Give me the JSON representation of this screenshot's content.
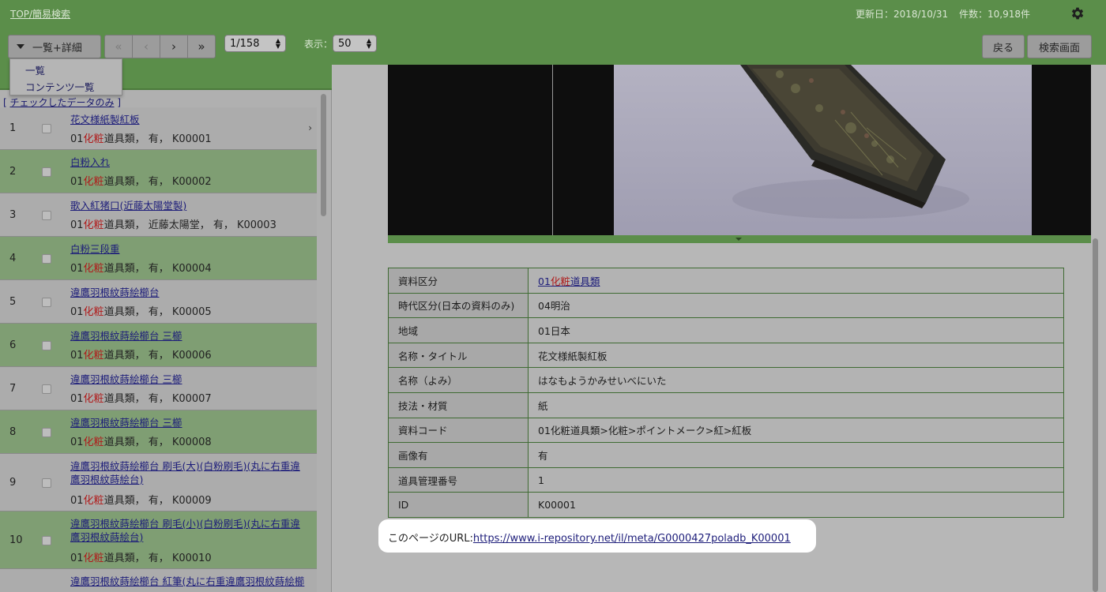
{
  "header": {
    "breadcrumb": "TOP/簡易検索",
    "updated": "更新日：2018/10/31",
    "count": "件数：10,918件",
    "icon": "gear-icon"
  },
  "toolbar": {
    "view_label": "一覧+詳細",
    "pager": [
      "«",
      "‹",
      "›",
      "»"
    ],
    "page_select": "1/158",
    "display_label": "表示：",
    "per_page": "50",
    "back_label": "戻る",
    "search_screen_label": "検索画面"
  },
  "dropdown": {
    "items": [
      "一覧",
      "コンテンツ一覧"
    ]
  },
  "left": {
    "checked_only": "チェックしたデータのみ",
    "rows": [
      {
        "num": "1",
        "title": "花文様紙製紅板",
        "pre": "01",
        "red": "化粧",
        "post": "道具類， 有， K00001"
      },
      {
        "num": "2",
        "title": "白粉入れ",
        "pre": "01",
        "red": "化粧",
        "post": "道具類， 有， K00002"
      },
      {
        "num": "3",
        "title": "歌入紅猪口(近藤太陽堂製)",
        "pre": "01",
        "red": "化粧",
        "post": "道具類， 近藤太陽堂， 有， K00003"
      },
      {
        "num": "4",
        "title": "白粉三段重",
        "pre": "01",
        "red": "化粧",
        "post": "道具類， 有， K00004"
      },
      {
        "num": "5",
        "title": "違鷹羽根紋蒔絵櫛台",
        "pre": "01",
        "red": "化粧",
        "post": "道具類， 有， K00005"
      },
      {
        "num": "6",
        "title": "違鷹羽根紋蒔絵櫛台 三櫛",
        "pre": "01",
        "red": "化粧",
        "post": "道具類， 有， K00006"
      },
      {
        "num": "7",
        "title": "違鷹羽根紋蒔絵櫛台 三櫛",
        "pre": "01",
        "red": "化粧",
        "post": "道具類， 有， K00007"
      },
      {
        "num": "8",
        "title": "違鷹羽根紋蒔絵櫛台 三櫛",
        "pre": "01",
        "red": "化粧",
        "post": "道具類， 有， K00008"
      },
      {
        "num": "9",
        "title": "違鷹羽根紋蒔絵櫛台 刷毛(大)(白粉刷毛)(丸に右重違鷹羽根紋蒔絵台)",
        "pre": "01",
        "red": "化粧",
        "post": "道具類， 有， K00009"
      },
      {
        "num": "10",
        "title": "違鷹羽根紋蒔絵櫛台 刷毛(小)(白粉刷毛)(丸に右重違鷹羽根紋蒔絵台)",
        "pre": "01",
        "red": "化粧",
        "post": "道具類， 有， K00010"
      },
      {
        "num": "",
        "title": "違鷹羽根紋蒔絵櫛台 紅筆(丸に右重違鷹羽根紋蒔絵櫛",
        "pre": "",
        "red": "",
        "post": ""
      }
    ]
  },
  "detail": {
    "rows": [
      {
        "key": "資料区分",
        "pre": "01",
        "red": "化粧",
        "post": "道具類",
        "link": true
      },
      {
        "key": "時代区分(日本の資料のみ)",
        "value": "04明治"
      },
      {
        "key": "地域",
        "value": "01日本"
      },
      {
        "key": "名称・タイトル",
        "value": "花文様紙製紅板"
      },
      {
        "key": "名称（よみ）",
        "value": "はなもようかみせいべにいた"
      },
      {
        "key": "技法・材質",
        "value": "紙"
      },
      {
        "key": "資料コード",
        "value": "01化粧道具類>化粧>ポイントメーク>紅>紅板"
      },
      {
        "key": "画像有",
        "value": "有"
      },
      {
        "key": "道具管理番号",
        "value": "1"
      },
      {
        "key": "ID",
        "value": "K00001"
      }
    ],
    "url_label": "このページのURL:",
    "url": "https://www.i-repository.net/il/meta/G0000427poladb_K00001"
  },
  "colors": {
    "header_green": "#5b8e4a",
    "row_green": "#7f9e73",
    "highlight_red": "#b01a1a",
    "link_blue": "#1d1d7a"
  }
}
